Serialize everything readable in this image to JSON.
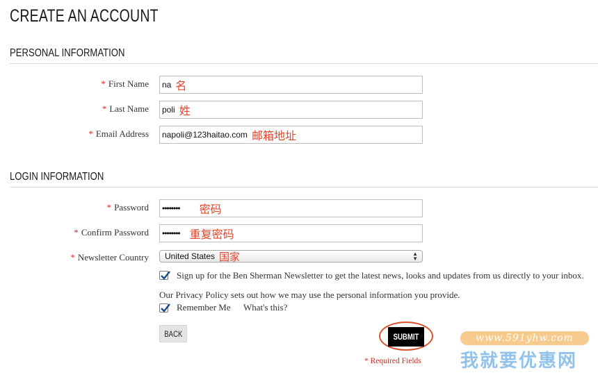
{
  "page_title": "CREATE AN ACCOUNT",
  "personal": {
    "title": "PERSONAL INFORMATION",
    "first_name": {
      "label": "First Name",
      "value": "na",
      "note": "名"
    },
    "last_name": {
      "label": "Last Name",
      "value": "poli",
      "note": "姓"
    },
    "email": {
      "label": "Email Address",
      "value": "napoli@123haitao.com",
      "note": "邮箱地址"
    }
  },
  "login": {
    "title": "LOGIN INFORMATION",
    "password": {
      "label": "Password",
      "value": "••••••••",
      "note": "密码"
    },
    "confirm_password": {
      "label": "Confirm Password",
      "value": "••••••••",
      "note": "重复密码"
    },
    "country": {
      "label": "Newsletter Country",
      "value": "United States",
      "note": "国家"
    }
  },
  "required_marker": "*",
  "newsletter_text": "Sign up for the Ben Sherman Newsletter to get the latest news, looks and updates from us directly to your inbox.",
  "privacy_text": "Our Privacy Policy sets out how we may use the personal information you provide.",
  "remember_me": "Remember Me",
  "whats_this": "What's this?",
  "back_label": "BACK",
  "submit_label": "SUBMIT",
  "required_fields": "* Required Fields",
  "watermark": {
    "url": "www.591yhw.com",
    "text": "我就要优惠网"
  },
  "colors": {
    "required": "#c9302c",
    "annotation": "#e0452b",
    "submit_bg": "#000000",
    "ring": "#d9532c"
  }
}
